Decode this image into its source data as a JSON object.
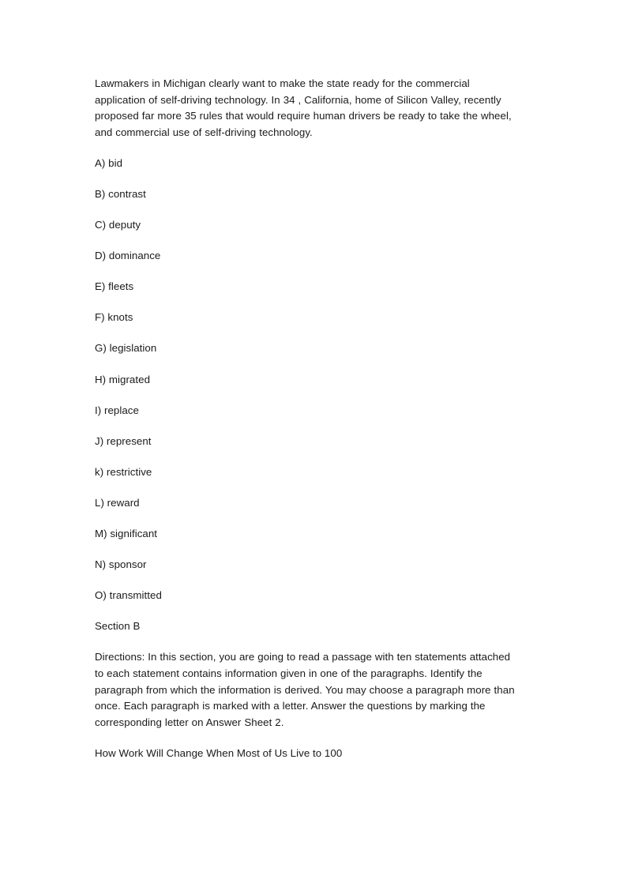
{
  "document": {
    "passage": {
      "text": "Lawmakers in Michigan clearly want to make the state ready for the commercial application of self-driving technology. In 34 , California, home of Silicon Valley, recently proposed far more 35 rules that would require human drivers be ready to take the wheel, and commercial use of self-driving technology."
    },
    "options": [
      {
        "label": "A) bid"
      },
      {
        "label": "B) contrast"
      },
      {
        "label": "C) deputy"
      },
      {
        "label": "D) dominance"
      },
      {
        "label": "E) fleets"
      },
      {
        "label": "F) knots"
      },
      {
        "label": "G) legislation"
      },
      {
        "label": "H) migrated"
      },
      {
        "label": "I) replace"
      },
      {
        "label": "J) represent"
      },
      {
        "label": "k) restrictive"
      },
      {
        "label": "L) reward"
      },
      {
        "label": "M) significant"
      },
      {
        "label": "N) sponsor"
      },
      {
        "label": "O) transmitted"
      }
    ],
    "section_label": "Section B",
    "directions": {
      "text": "Directions: In this section, you are going to read a passage with ten statements attached to each statement contains information given in one of the paragraphs. Identify the paragraph from which the information is derived. You may choose a paragraph more than once. Each paragraph is marked with a letter. Answer the questions by marking the corresponding letter on Answer Sheet 2."
    },
    "article_title": "How Work Will Change When Most of Us Live to 100"
  },
  "colors": {
    "page_background": "#ffffff",
    "text": "#1a1a1a"
  }
}
